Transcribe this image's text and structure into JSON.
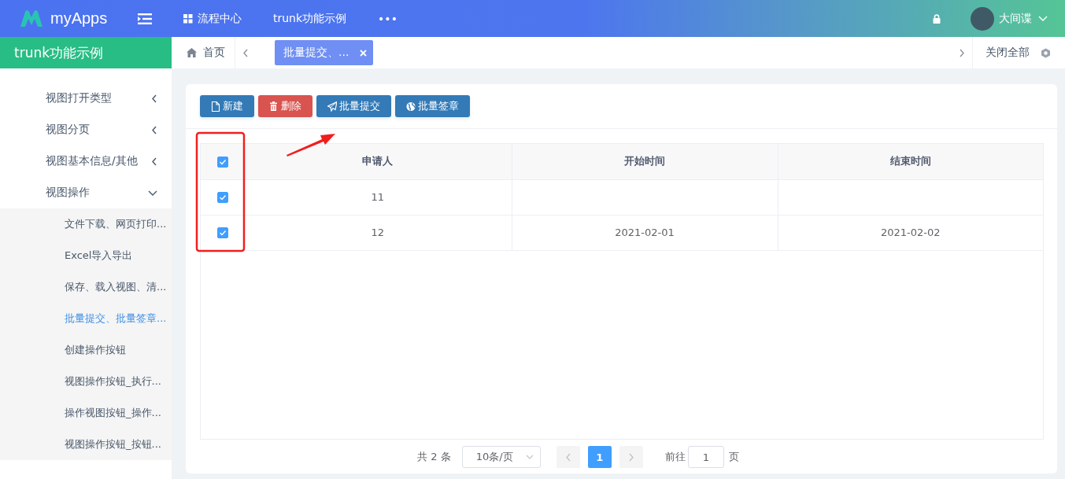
{
  "header": {
    "logo": "myApps",
    "menu": [
      {
        "label": "流程中心",
        "kind": "grid"
      },
      {
        "label": "trunk功能示例",
        "kind": "text"
      },
      {
        "label": "•••",
        "kind": "text"
      }
    ],
    "user": {
      "name": "大间谍"
    }
  },
  "sidebar": {
    "title": "trunk功能示例",
    "items": [
      {
        "label": "视图打开类型",
        "expanded": false
      },
      {
        "label": "视图分页",
        "expanded": false
      },
      {
        "label": "视图基本信息/其他",
        "expanded": false
      },
      {
        "label": "视图操作",
        "expanded": true,
        "children": [
          {
            "label": "文件下载、网页打印...",
            "selected": false
          },
          {
            "label": "Excel导入导出",
            "selected": false
          },
          {
            "label": "保存、载入视图、清...",
            "selected": false
          },
          {
            "label": "批量提交、批量签章...",
            "selected": true
          },
          {
            "label": "创建操作按钮",
            "selected": false
          },
          {
            "label": "视图操作按钮_执行...",
            "selected": false
          },
          {
            "label": "操作视图按钮_操作...",
            "selected": false
          },
          {
            "label": "视图操作按钮_按钮...",
            "selected": false
          }
        ]
      }
    ]
  },
  "tabs": {
    "home": "首页",
    "items": [
      {
        "label": "批量提交、...",
        "selected": true
      }
    ],
    "close_all": "关闭全部"
  },
  "toolbar": [
    {
      "label": "新建",
      "kind": "new"
    },
    {
      "label": "删除",
      "kind": "delete"
    },
    {
      "label": "批量提交",
      "kind": "submit"
    },
    {
      "label": "批量签章",
      "kind": "sign"
    }
  ],
  "table": {
    "columns": [
      "申请人",
      "开始时间",
      "结束时间"
    ],
    "header_checked": true,
    "rows": [
      {
        "checked": true,
        "cells": [
          "11",
          null,
          null
        ]
      },
      {
        "checked": true,
        "cells": [
          "12",
          "2021-02-01",
          "2021-02-02"
        ]
      }
    ]
  },
  "pagination": {
    "total": "共 2 条",
    "page_size": "10条/页",
    "pages": [
      {
        "label": "1",
        "selected": true
      }
    ],
    "goto_label": "前往",
    "goto_value": "1",
    "goto_suffix": "页"
  }
}
